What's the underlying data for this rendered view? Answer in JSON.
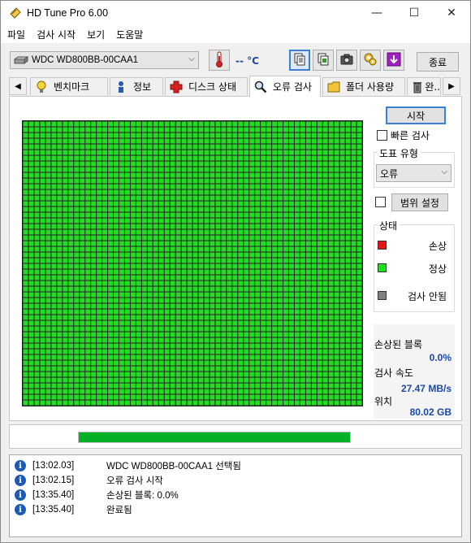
{
  "window": {
    "title": "HD Tune Pro 6.00",
    "controls": {
      "minimize": "—",
      "maximize": "☐",
      "close": "✕"
    }
  },
  "menu": [
    "파일",
    "검사 시작",
    "보기",
    "도움말"
  ],
  "toolbar": {
    "drive": "WDC WD800BB-00CAA1",
    "temperature": "-- °C",
    "exit_label": "종료",
    "icons": [
      "thermometer-icon",
      "copy-text-icon",
      "copy-screenshot-icon",
      "camera-icon",
      "options-icon",
      "save-icon"
    ]
  },
  "tabs": [
    {
      "label": "벤치마크",
      "icon": "lightbulb-icon"
    },
    {
      "label": "정보",
      "icon": "info-person-icon"
    },
    {
      "label": "디스크 상태",
      "icon": "health-cross-icon"
    },
    {
      "label": "오류 검사",
      "icon": "magnifier-icon",
      "active": true
    },
    {
      "label": "폴더 사용량",
      "icon": "folder-icon"
    },
    {
      "label": "완..",
      "icon": "trash-icon"
    }
  ],
  "error_scan": {
    "start_label": "시작",
    "quick_scan_label": "빠른 검사",
    "map_type_title": "도표 유형",
    "map_type_value": "오류",
    "range_label": "범위 설정",
    "status_title": "상태",
    "legend": [
      {
        "label": "손상",
        "color": "#e11515"
      },
      {
        "label": "정상",
        "color": "#22dd22"
      },
      {
        "label": "검사 안됨",
        "color": "#808080"
      }
    ],
    "stats": [
      {
        "label": "손상된 블록",
        "value": "0.0%"
      },
      {
        "label": "검사 속도",
        "value": "27.47 MB/s"
      },
      {
        "label": "위치",
        "value": "80.02 GB"
      }
    ],
    "block_map": {
      "status": "all-ok",
      "color": "#22dd22",
      "columns": 60,
      "rows": 50
    }
  },
  "progress": {
    "fraction": 1.0
  },
  "log": [
    {
      "time": "[13:02.03]",
      "message": "WDC WD800BB-00CAA1 선택됨"
    },
    {
      "time": "[13:02.15]",
      "message": "오류 검사 시작"
    },
    {
      "time": "[13:35.40]",
      "message": "손상된 블록: 0.0%"
    },
    {
      "time": "[13:35.40]",
      "message": "완료됨"
    }
  ]
}
